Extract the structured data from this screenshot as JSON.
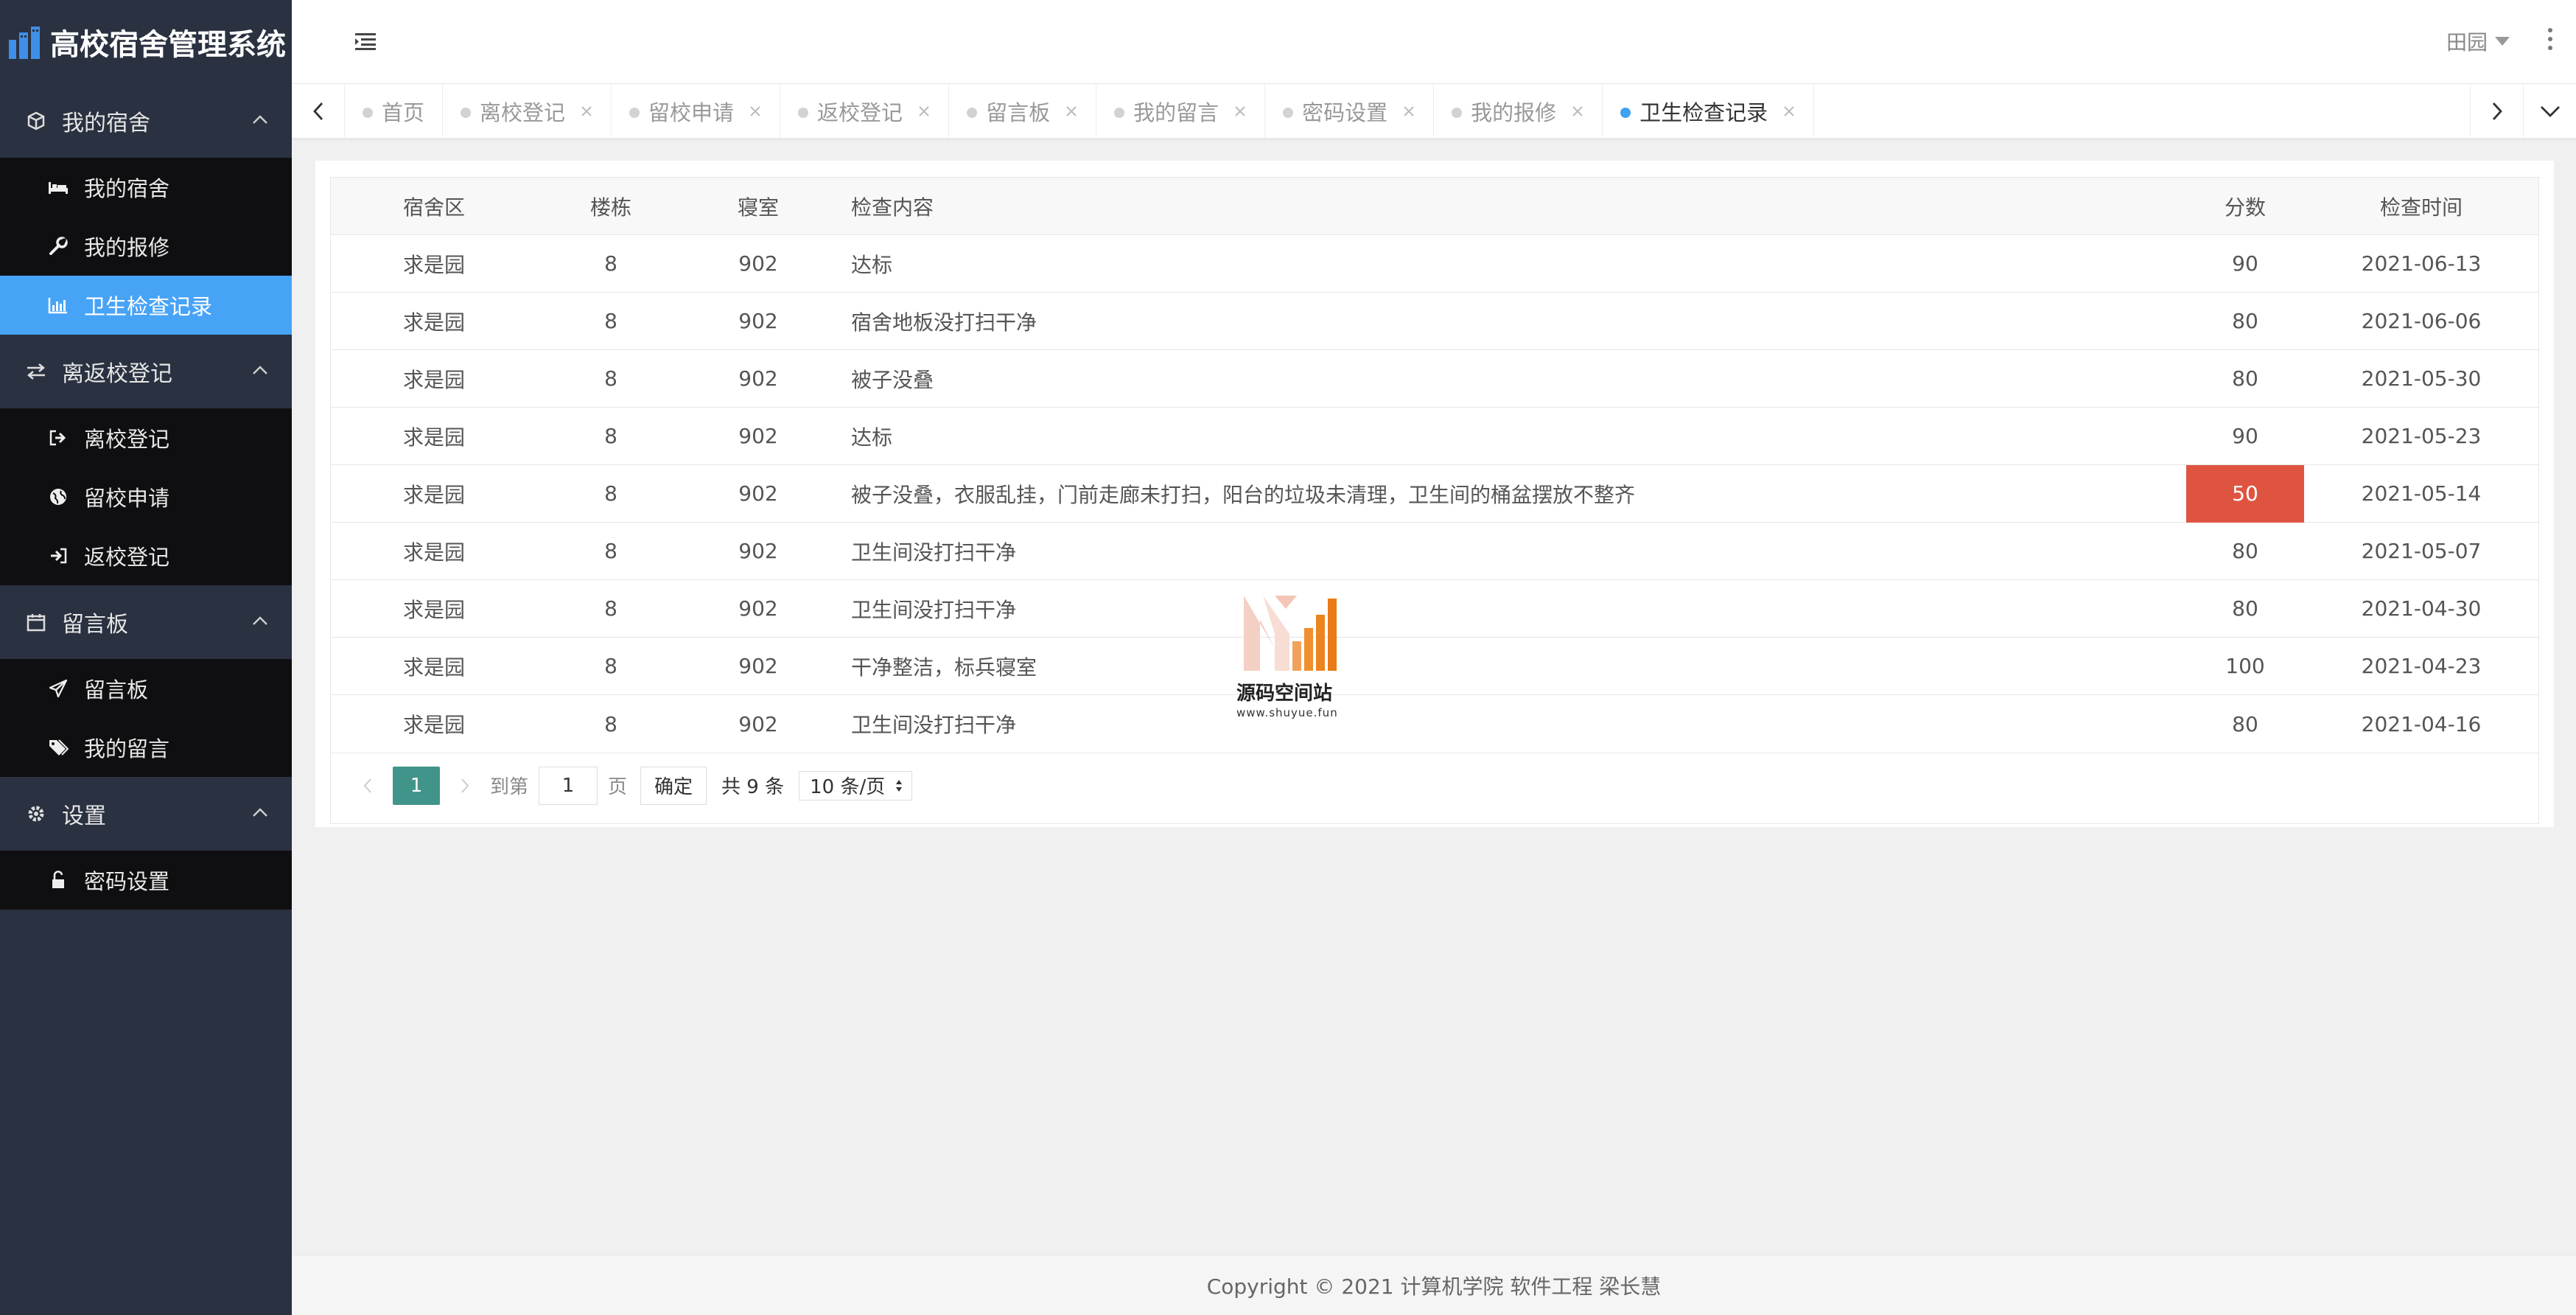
{
  "app": {
    "title": "高校宿舍管理系统"
  },
  "sidebar": {
    "groups": [
      {
        "label": "我的宿舍",
        "items": [
          {
            "label": "我的宿舍"
          },
          {
            "label": "我的报修"
          },
          {
            "label": "卫生检查记录"
          }
        ]
      },
      {
        "label": "离返校登记",
        "items": [
          {
            "label": "离校登记"
          },
          {
            "label": "留校申请"
          },
          {
            "label": "返校登记"
          }
        ]
      },
      {
        "label": "留言板",
        "items": [
          {
            "label": "留言板"
          },
          {
            "label": "我的留言"
          }
        ]
      },
      {
        "label": "设置",
        "items": [
          {
            "label": "密码设置"
          }
        ]
      }
    ],
    "active_item": "卫生检查记录"
  },
  "topbar": {
    "user_name": "田园"
  },
  "tabs": [
    {
      "label": "首页",
      "closable": false
    },
    {
      "label": "离校登记",
      "closable": true
    },
    {
      "label": "留校申请",
      "closable": true
    },
    {
      "label": "返校登记",
      "closable": true
    },
    {
      "label": "留言板",
      "closable": true
    },
    {
      "label": "我的留言",
      "closable": true
    },
    {
      "label": "密码设置",
      "closable": true
    },
    {
      "label": "我的报修",
      "closable": true
    },
    {
      "label": "卫生检查记录",
      "closable": true,
      "active": true
    }
  ],
  "table": {
    "headers": {
      "area": "宿舍区",
      "building": "楼栋",
      "room": "寝室",
      "content": "检查内容",
      "score": "分数",
      "time": "检查时间"
    },
    "rows": [
      {
        "area": "求是园",
        "building": "8",
        "room": "902",
        "content": "达标",
        "score": "90",
        "time": "2021-06-13"
      },
      {
        "area": "求是园",
        "building": "8",
        "room": "902",
        "content": "宿舍地板没打扫干净",
        "score": "80",
        "time": "2021-06-06"
      },
      {
        "area": "求是园",
        "building": "8",
        "room": "902",
        "content": "被子没叠",
        "score": "80",
        "time": "2021-05-30"
      },
      {
        "area": "求是园",
        "building": "8",
        "room": "902",
        "content": "达标",
        "score": "90",
        "time": "2021-05-23"
      },
      {
        "area": "求是园",
        "building": "8",
        "room": "902",
        "content": "被子没叠，衣服乱挂，门前走廊未打扫，阳台的垃圾未清理，卫生间的桶盆摆放不整齐",
        "score": "50",
        "time": "2021-05-14",
        "low": true
      },
      {
        "area": "求是园",
        "building": "8",
        "room": "902",
        "content": "卫生间没打扫干净",
        "score": "80",
        "time": "2021-05-07"
      },
      {
        "area": "求是园",
        "building": "8",
        "room": "902",
        "content": "卫生间没打扫干净",
        "score": "80",
        "time": "2021-04-30"
      },
      {
        "area": "求是园",
        "building": "8",
        "room": "902",
        "content": "干净整洁，标兵寝室",
        "score": "100",
        "time": "2021-04-23"
      },
      {
        "area": "求是园",
        "building": "8",
        "room": "902",
        "content": "卫生间没打扫干净",
        "score": "80",
        "time": "2021-04-16"
      }
    ]
  },
  "pager": {
    "current_page": "1",
    "goto_prefix": "到第",
    "goto_value": "1",
    "goto_suffix": "页",
    "confirm_label": "确定",
    "total_text": "共 9 条",
    "page_size": "10 条/页"
  },
  "watermark": {
    "title": "源码空间站",
    "url": "www.shuyue.fun"
  },
  "footer": {
    "text": "Copyright © 2021 计算机学院 软件工程 梁长慧"
  },
  "colors": {
    "active_menu": "#47a3f6",
    "sidebar_bg": "#2a3140",
    "pager_active": "#419489",
    "low_score": "#df5441",
    "active_tab_dot": "#3fa2f2"
  }
}
